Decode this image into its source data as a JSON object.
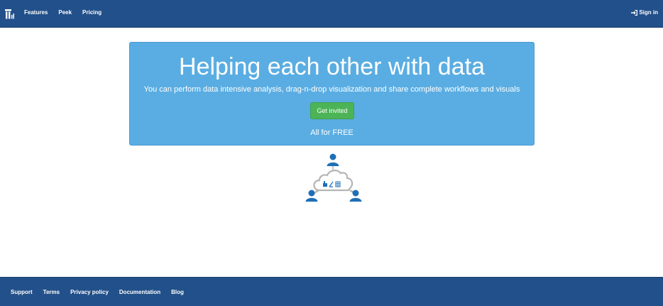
{
  "navbar": {
    "logo_icon": "bar-logo-icon",
    "links": [
      {
        "label": "Features"
      },
      {
        "label": "Peek"
      },
      {
        "label": "Pricing"
      }
    ],
    "signin": {
      "label": "Sign in",
      "icon": "sign-in-icon"
    }
  },
  "hero": {
    "title": "Helping each other with data",
    "subtitle": "You can perform data intensive analysis, drag-n-drop visualization and share complete workflows and visuals",
    "cta_label": "Get invited",
    "tagline": "All for FREE"
  },
  "illustration": {
    "icon": "cloud-collaboration-icon"
  },
  "footer": {
    "links": [
      {
        "label": "Support"
      },
      {
        "label": "Terms"
      },
      {
        "label": "Privacy policy"
      },
      {
        "label": "Documentation"
      },
      {
        "label": "Blog"
      }
    ]
  },
  "colors": {
    "navbar_bg": "#22508a",
    "hero_bg": "#5aade2",
    "cta_bg": "#4cb456",
    "illustration_blue": "#1f6fb6",
    "illustration_gray": "#b5b5b5"
  }
}
